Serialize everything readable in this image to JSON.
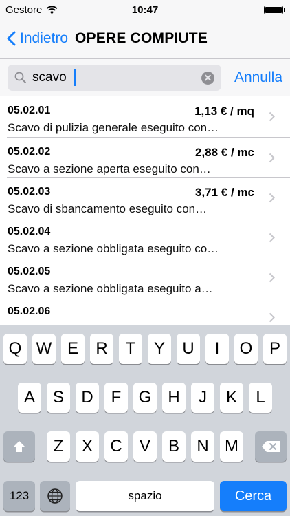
{
  "status": {
    "carrier": "Gestore",
    "time": "10:47"
  },
  "nav": {
    "back_label": "Indietro",
    "title": "OPERE COMPIUTE"
  },
  "search": {
    "value": "scavo",
    "cancel_label": "Annulla"
  },
  "items": [
    {
      "code": "05.02.01",
      "price": "1,13 € / mq",
      "desc": "Scavo di pulizia generale eseguito con…"
    },
    {
      "code": "05.02.02",
      "price": "2,88 € / mc",
      "desc": "Scavo a sezione aperta eseguito con…"
    },
    {
      "code": "05.02.03",
      "price": "3,71 € / mc",
      "desc": "Scavo di sbancamento eseguito con…"
    },
    {
      "code": "05.02.04",
      "price": "",
      "desc": "Scavo a sezione obbligata eseguito co…"
    },
    {
      "code": "05.02.05",
      "price": "",
      "desc": "Scavo a sezione obbligata eseguito a…"
    },
    {
      "code": "05.02.06",
      "price": "",
      "desc": ""
    }
  ],
  "keyboard": {
    "row1": [
      "Q",
      "W",
      "E",
      "R",
      "T",
      "Y",
      "U",
      "I",
      "O",
      "P"
    ],
    "row2": [
      "A",
      "S",
      "D",
      "F",
      "G",
      "H",
      "J",
      "K",
      "L"
    ],
    "row3": [
      "Z",
      "X",
      "C",
      "V",
      "B",
      "N",
      "M"
    ],
    "numbers_label": "123",
    "space_label": "spazio",
    "search_label": "Cerca"
  }
}
